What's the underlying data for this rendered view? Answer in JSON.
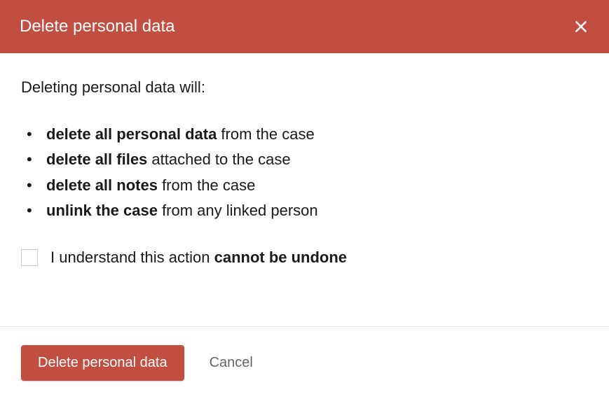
{
  "header": {
    "title": "Delete personal data"
  },
  "body": {
    "intro": "Deleting personal data will:",
    "bullets": [
      {
        "bold": "delete all personal data",
        "rest": " from the case"
      },
      {
        "bold": "delete all files",
        "rest": " attached to the case"
      },
      {
        "bold": "delete all notes",
        "rest": " from the case"
      },
      {
        "bold": "unlink the case",
        "rest": " from any linked person"
      }
    ],
    "confirm": {
      "prefix": "I understand this action ",
      "bold": "cannot be undone"
    }
  },
  "footer": {
    "primary_label": "Delete personal data",
    "cancel_label": "Cancel"
  },
  "colors": {
    "accent": "#c14e40"
  }
}
